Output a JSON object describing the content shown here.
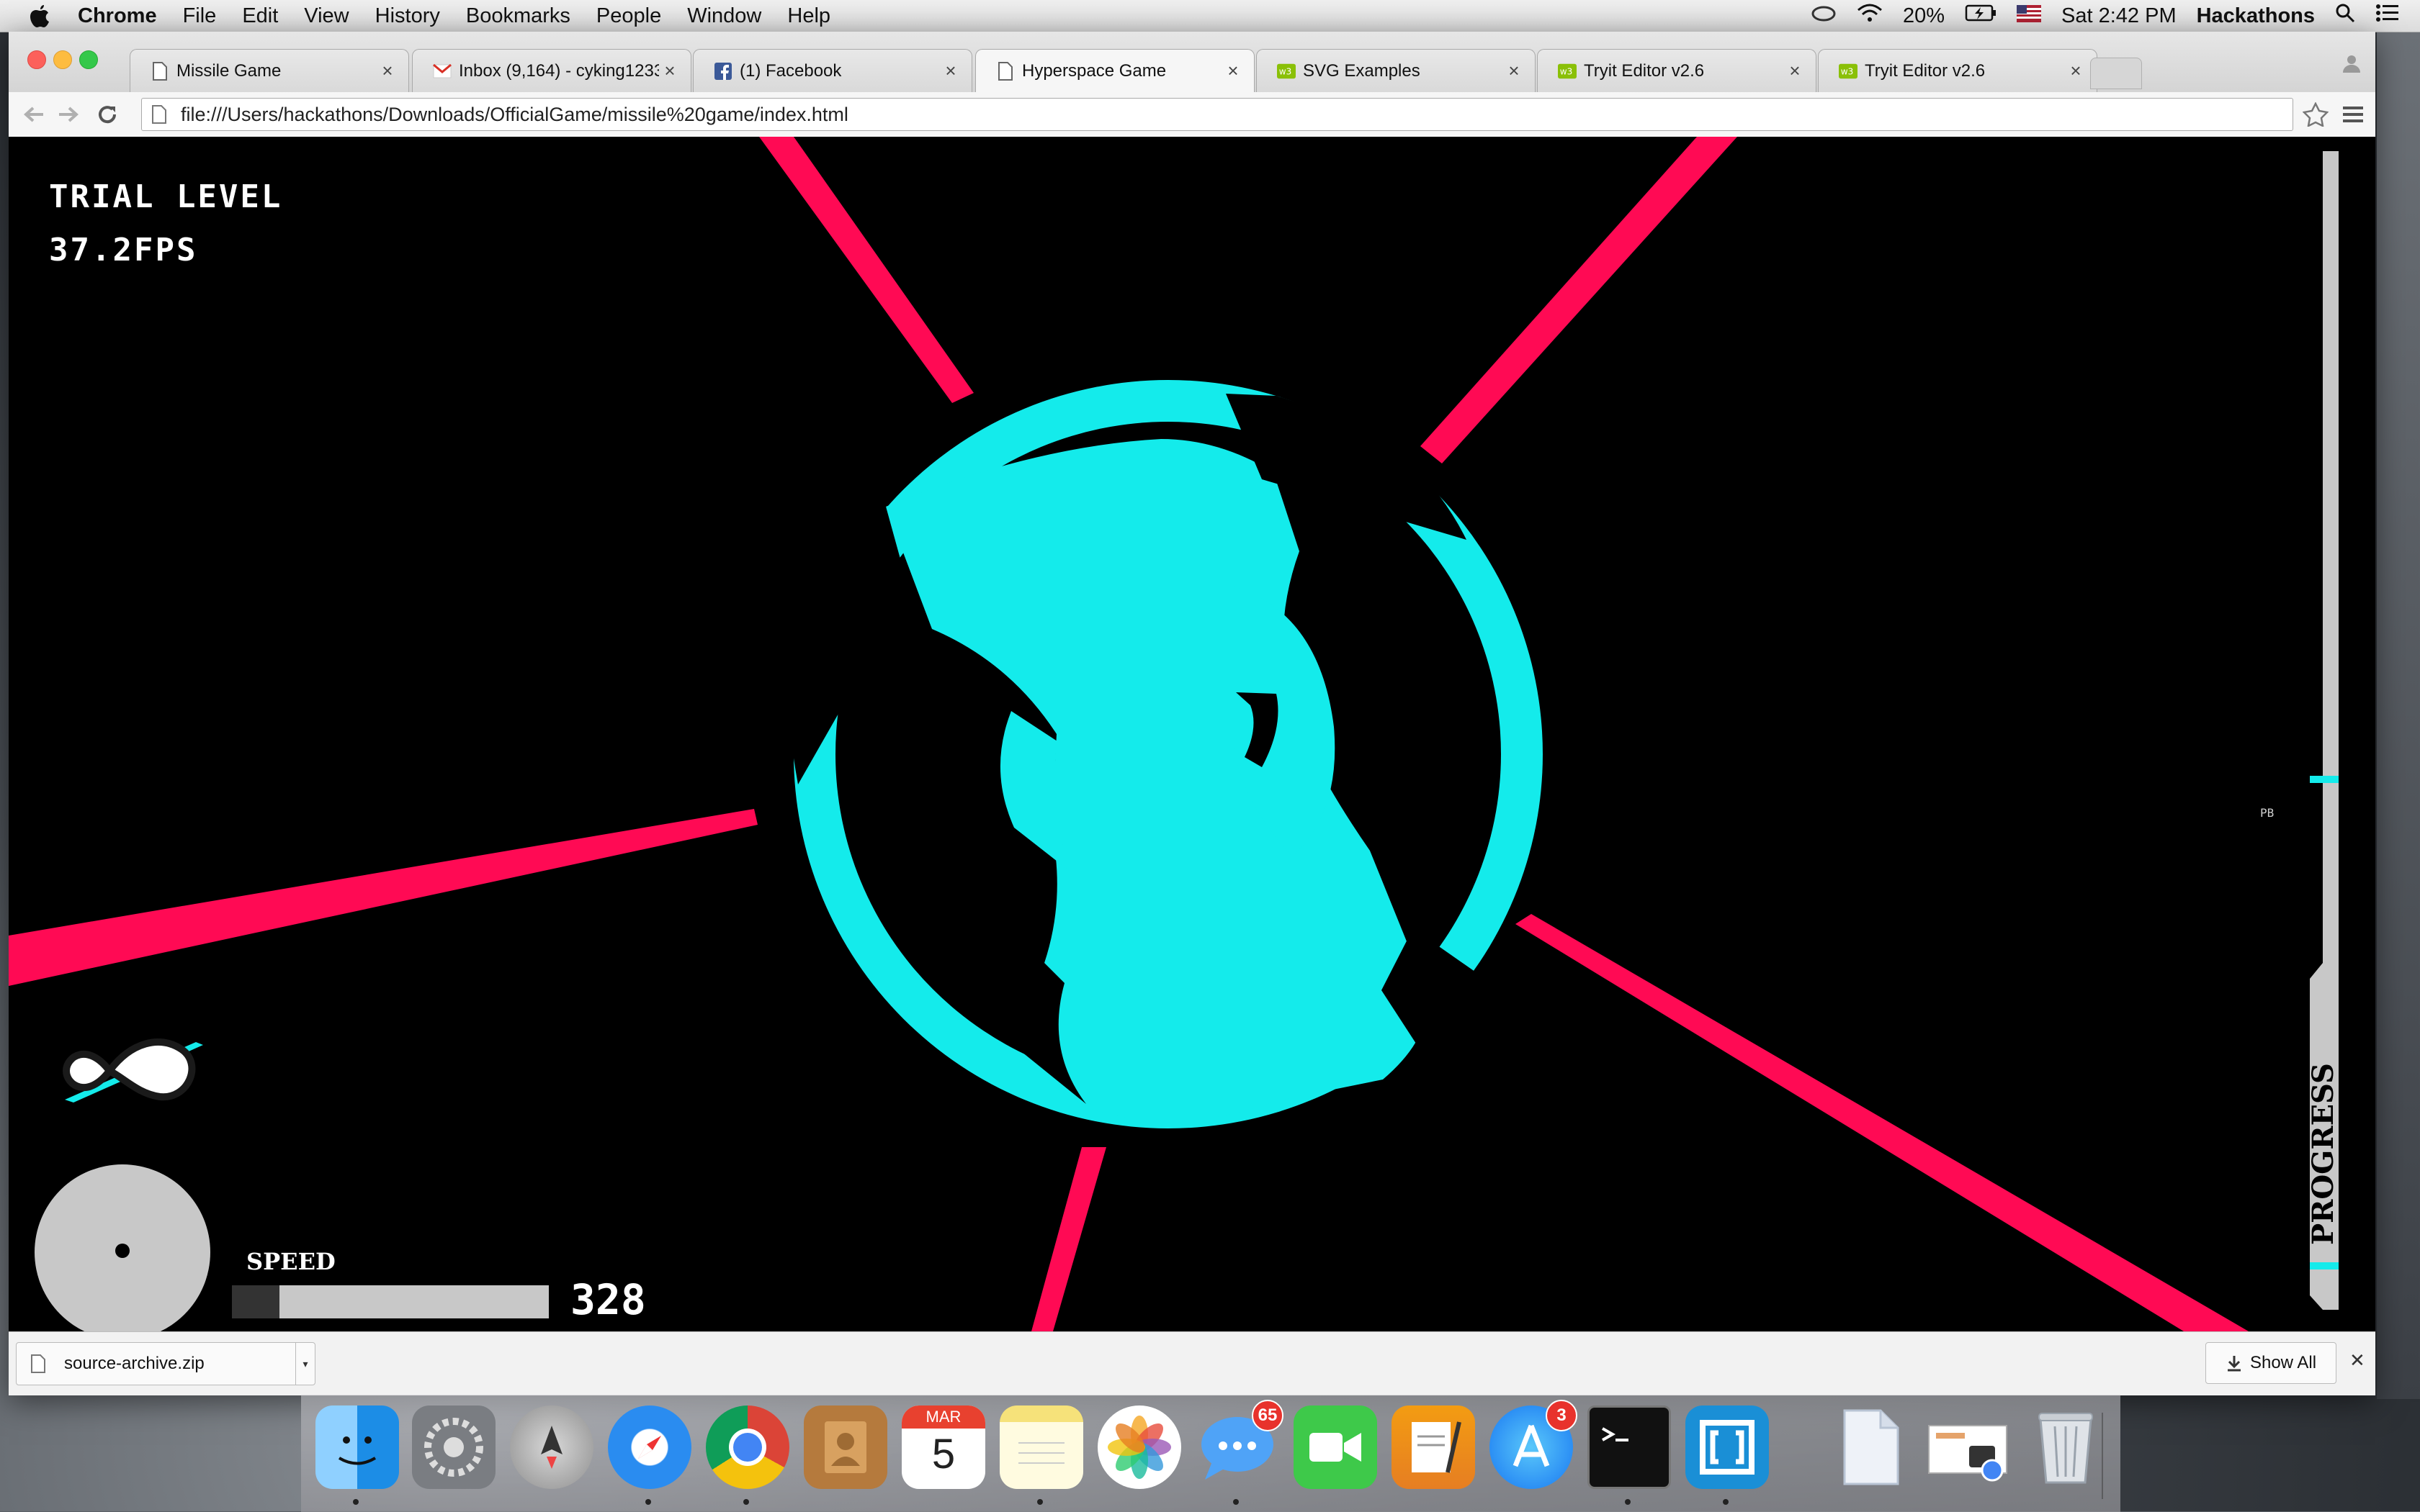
{
  "menubar": {
    "app": "Chrome",
    "items": [
      "File",
      "Edit",
      "View",
      "History",
      "Bookmarks",
      "People",
      "Window",
      "Help"
    ],
    "battery": "20%",
    "clock": "Sat 2:42 PM",
    "user": "Hackathons"
  },
  "tabs": [
    {
      "title": "Missile Game",
      "icon": "page-icon"
    },
    {
      "title": "Inbox (9,164) - cyking1233",
      "icon": "gmail-icon"
    },
    {
      "title": "(1) Facebook",
      "icon": "facebook-icon"
    },
    {
      "title": "Hyperspace Game",
      "icon": "page-icon",
      "active": true
    },
    {
      "title": "SVG Examples",
      "icon": "w3schools-icon"
    },
    {
      "title": "Tryit Editor v2.6",
      "icon": "w3schools-icon"
    },
    {
      "title": "Tryit Editor v2.6",
      "icon": "w3schools-icon"
    }
  ],
  "address": {
    "url": "file:///Users/hackathons/Downloads/OfficialGame/missile%20game/index.html"
  },
  "game": {
    "level_text": "TRIAL LEVEL",
    "fps_text": "37.2FPS",
    "speed_label": "SPEED",
    "speed_value": "328",
    "speed_fraction": 0.15,
    "pb_label": "PB",
    "progress_label": "PROGRESS",
    "colors": {
      "cyan": "#14ebeb",
      "ray": "#ff0a54",
      "background": "#000000",
      "hud_gray": "#c8c8c8"
    }
  },
  "downloads": {
    "file": "source-archive.zip",
    "show_all": "Show All"
  },
  "dock": {
    "apps": [
      {
        "name": "finder"
      },
      {
        "name": "system-preferences"
      },
      {
        "name": "launchpad"
      },
      {
        "name": "safari"
      },
      {
        "name": "chrome"
      },
      {
        "name": "contacts"
      },
      {
        "name": "calendar",
        "month": "MAR",
        "day": "5"
      },
      {
        "name": "notes"
      },
      {
        "name": "photos"
      },
      {
        "name": "messages",
        "badge": "65"
      },
      {
        "name": "facetime"
      },
      {
        "name": "pages"
      },
      {
        "name": "app-store",
        "badge": "3"
      },
      {
        "name": "terminal"
      },
      {
        "name": "brackets"
      },
      {
        "name": "document"
      },
      {
        "name": "preview"
      },
      {
        "name": "trash"
      }
    ]
  }
}
